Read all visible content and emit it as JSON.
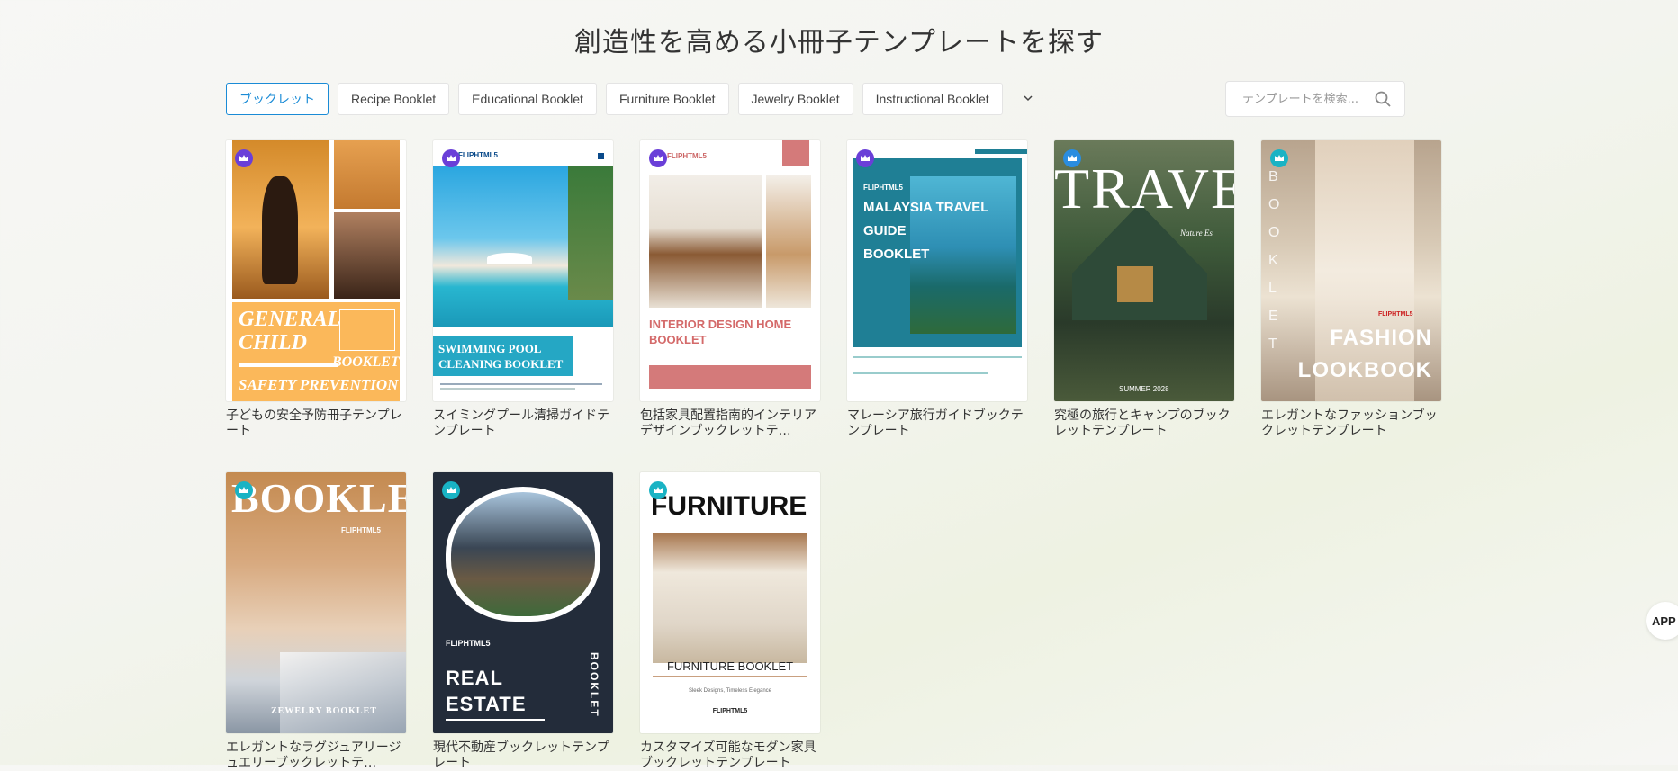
{
  "page": {
    "title": "創造性を高める小冊子テンプレートを探す"
  },
  "filters": [
    {
      "label": "ブックレット",
      "active": true
    },
    {
      "label": "Recipe Booklet"
    },
    {
      "label": "Educational Booklet"
    },
    {
      "label": "Furniture Booklet"
    },
    {
      "label": "Jewelry Booklet"
    },
    {
      "label": "Instructional Booklet"
    }
  ],
  "search": {
    "placeholder": "テンプレートを検索..."
  },
  "colors": {
    "accent": "#1a8bd6",
    "badge_purple": "#6a3fd8",
    "badge_blue": "#2a8de0",
    "badge_teal": "#19b3c4"
  },
  "templates": [
    {
      "title": "子どもの安全予防冊子テンプレート",
      "badge": "crown-purple",
      "cover": {
        "line1": "GENERAL",
        "line2": "CHILD",
        "tag": "BOOKLET",
        "footer": "SAFETY PREVENTION"
      }
    },
    {
      "title": "スイミングプール清掃ガイドテンプレート",
      "badge": "crown-purple",
      "cover": {
        "brand": "FLIPHTML5",
        "heading1": "SWIMMING POOL",
        "heading2": "CLEANING BOOKLET"
      }
    },
    {
      "title": "包括家具配置指南的インテリアデザインブックレットテ…",
      "badge": "crown-purple",
      "cover": {
        "brand": "FLIPHTML5",
        "heading1": "INTERIOR DESIGN HOME",
        "heading2": "BOOKLET"
      }
    },
    {
      "title": "マレーシア旅行ガイドブックテンプレート",
      "badge": "crown-purple",
      "cover": {
        "brand": "FLIPHTML5",
        "heading1": "MALAYSIA TRAVEL GUIDE",
        "heading2": "BOOKLET"
      }
    },
    {
      "title": "究極の旅行とキャンプのブックレットテンプレート",
      "badge": "crown-blue",
      "cover": {
        "big": "TRAVE",
        "sub": "Nature Es",
        "footer": "SUMMER 2028"
      }
    },
    {
      "title": "エレガントなファッションブックレットテンプレート",
      "badge": "crown-teal",
      "cover": {
        "brand": "FLIPHTML5",
        "heading1": "FASHION",
        "heading2": "LOOKBOOK",
        "vertical": "BOOKLET"
      }
    },
    {
      "title": "エレガントなラグジュアリージュエリーブックレットテ…",
      "badge": "crown-teal",
      "cover": {
        "big": "BOOKLET",
        "brand": "FLIPHTML5",
        "footer": "ZEWELRY BOOKLET"
      }
    },
    {
      "title": "現代不動産ブックレットテンプレート",
      "badge": "crown-teal",
      "cover": {
        "brand": "FLIPHTML5",
        "heading1": "REAL",
        "heading2": "ESTATE",
        "vertical": "BOOKLET"
      }
    },
    {
      "title": "カスタマイズ可能なモダン家具ブックレットテンプレート",
      "badge": "crown-teal",
      "cover": {
        "big": "FURNITURE",
        "heading1": "FURNITURE BOOKLET",
        "sub": "Sleek Designs, Timeless Elegance",
        "brand": "FLIPHTML5"
      }
    }
  ],
  "floating": {
    "app_label": "APP"
  }
}
